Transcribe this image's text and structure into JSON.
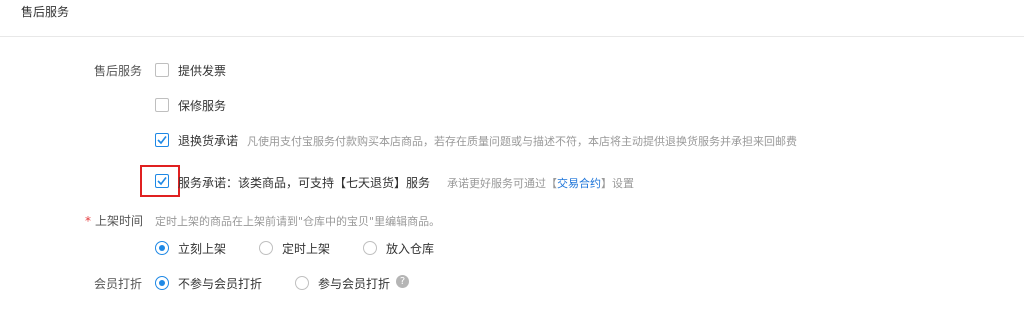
{
  "header": {
    "title": "售后服务"
  },
  "after_sales": {
    "label": "售后服务",
    "options": [
      {
        "label": "提供发票",
        "checked": false
      },
      {
        "label": "保修服务",
        "checked": false
      },
      {
        "label": "退换货承诺",
        "checked": true,
        "hint": "凡使用支付宝服务付款购买本店商品，若存在质量问题或与描述不符，本店将主动提供退换货服务并承担来回邮费"
      },
      {
        "label": "服务承诺：该类商品，可支持【七天退货】服务",
        "checked": true
      }
    ],
    "promise_hint_prefix": "承诺更好服务可通过【",
    "promise_hint_link": "交易合约",
    "promise_hint_suffix": "】设置"
  },
  "listing_time": {
    "required_mark": "*",
    "label": "上架时间",
    "hint": "定时上架的商品在上架前请到\"仓库中的宝贝\"里编辑商品。",
    "options": [
      "立刻上架",
      "定时上架",
      "放入仓库"
    ],
    "selected": "立刻上架"
  },
  "member_discount": {
    "label": "会员打折",
    "options": [
      "不参与会员打折",
      "参与会员打折"
    ],
    "selected": "不参与会员打折",
    "help_icon_text": "?"
  },
  "colors": {
    "accent": "#1e88e5",
    "highlight": "#e02020"
  }
}
